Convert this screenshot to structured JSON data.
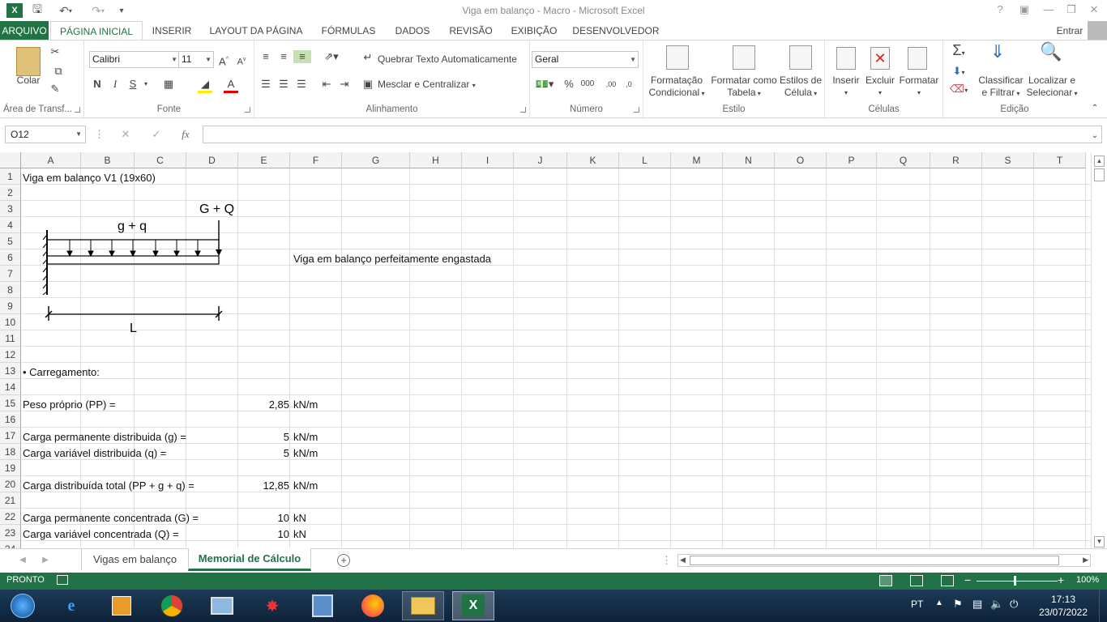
{
  "window": {
    "title": "Viga em balanço - Macro - Microsoft Excel",
    "help": "?",
    "user": "Entrar"
  },
  "menu": {
    "file": "ARQUIVO",
    "tabs": [
      "PÁGINA INICIAL",
      "INSERIR",
      "LAYOUT DA PÁGINA",
      "FÓRMULAS",
      "DADOS",
      "REVISÃO",
      "EXIBIÇÃO",
      "DESENVOLVEDOR"
    ]
  },
  "ribbon": {
    "clipboard": {
      "paste": "Colar",
      "label": "Área de Transf..."
    },
    "font": {
      "name": "Calibri",
      "size": "11",
      "bold": "N",
      "italic": "I",
      "underline": "S",
      "label": "Fonte"
    },
    "alignment": {
      "wrap": "Quebrar Texto Automaticamente",
      "merge": "Mesclar e Centralizar",
      "label": "Alinhamento"
    },
    "number": {
      "format": "Geral",
      "label": "Número"
    },
    "styles": {
      "cond1": "Formatação",
      "cond2": "Condicional",
      "table1": "Formatar como",
      "table2": "Tabela",
      "cell1": "Estilos de",
      "cell2": "Célula",
      "label": "Estilo"
    },
    "cells": {
      "insert": "Inserir",
      "delete": "Excluir",
      "format": "Formatar",
      "label": "Células"
    },
    "editing": {
      "sort1": "Classificar",
      "sort2": "e Filtrar",
      "find1": "Localizar e",
      "find2": "Selecionar",
      "label": "Edição"
    }
  },
  "formula_bar": {
    "name_box": "O12",
    "formula": ""
  },
  "columns": [
    "A",
    "B",
    "C",
    "D",
    "E",
    "F",
    "G",
    "H",
    "I",
    "J",
    "K",
    "L",
    "M",
    "N",
    "O",
    "P",
    "Q",
    "R",
    "S",
    "T"
  ],
  "rows": [
    "1",
    "2",
    "3",
    "4",
    "5",
    "6",
    "7",
    "8",
    "9",
    "10",
    "11",
    "12",
    "13",
    "14",
    "15",
    "16",
    "17",
    "18",
    "19",
    "20",
    "21",
    "22",
    "23",
    "24"
  ],
  "cells": {
    "a1": "Viga em balanço V1 (19x60)",
    "f6": "Viga em balanço perfeitamente engastada",
    "a13": "• Carregamento:",
    "a15": "Peso próprio (PP) =",
    "e15": "2,85",
    "f15": "kN/m",
    "a17": "Carga permanente distribuida (g) =",
    "e17": "5",
    "f17": "kN/m",
    "a18": "Carga variável distribuida (q) =",
    "e18": "5",
    "f18": "kN/m",
    "a20": "Carga distribuída total (PP + g + q) =",
    "e20": "12,85",
    "f20": "kN/m",
    "a22": "Carga permanente concentrada (G) =",
    "e22": "10",
    "f22": "kN",
    "a23": "Carga variável concentrada (Q) =",
    "e23": "10",
    "f23": "kN"
  },
  "drawing": {
    "point_load": "G + Q",
    "dist_load": "g + q",
    "length": "L"
  },
  "sheets": {
    "tab1": "Vigas em balanço",
    "tab2": "Memorial de Cálculo"
  },
  "status": {
    "ready": "PRONTO",
    "zoom": "100%"
  },
  "taskbar": {
    "lang": "PT",
    "time": "17:13",
    "date": "23/07/2022"
  },
  "colors": {
    "excel_green": "#217346"
  }
}
